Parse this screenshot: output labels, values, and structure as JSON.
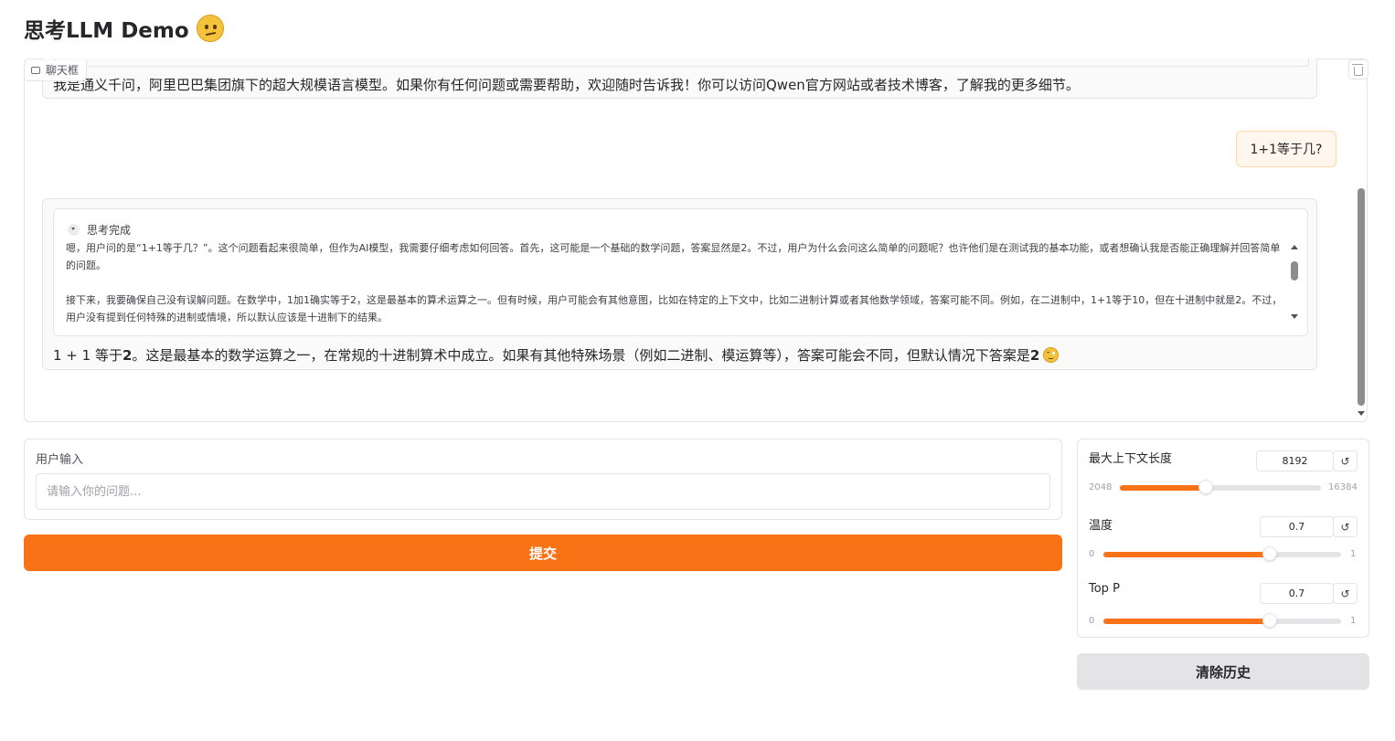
{
  "app": {
    "title": "思考LLM Demo",
    "title_emoji": "thinking-face-icon"
  },
  "chatbot": {
    "label": "聊天框",
    "messages": [
      {
        "role": "assistant",
        "text": "我是通义千问，阿里巴巴集团旗下的超大规模语言模型。如果你有任何问题或需要帮助，欢迎随时告诉我！你可以访问Qwen官方网站或者技术博客，了解我的更多细节。"
      },
      {
        "role": "user",
        "text": "1+1等于几?"
      },
      {
        "role": "assistant",
        "thinking": {
          "status": "思考完成",
          "paragraphs": [
            "嗯，用户问的是“1+1等于几？”。这个问题看起来很简单，但作为AI模型，我需要仔细考虑如何回答。首先，这可能是一个基础的数学问题，答案显然是2。不过，用户为什么会问这么简单的问题呢？也许他们是在测试我的基本功能，或者想确认我是否能正确理解并回答简单的问题。",
            "接下来，我要确保自己没有误解问题。在数学中，1加1确实等于2，这是最基本的算术运算之一。但有时候，用户可能会有其他意图，比如在特定的上下文中，比如二进制计算或者其他数学领域，答案可能不同。例如，在二进制中，1+1等于10，但在十进制中就是2。不过，用户没有提到任何特殊的进制或情境，所以默认应该是十进制下的结果。"
          ]
        },
        "answer": {
          "prefix": "1 + 1 等于 ",
          "value": "2",
          "middle": "。这是最基本的数学运算之一，在常规的十进制算术中成立。如果有其他特殊场景（例如二进制、模运算等），答案可能会不同，但默认情况下答案是 ",
          "value2": "2",
          "emoji": "smiling-face-icon"
        }
      }
    ]
  },
  "input": {
    "label": "用户输入",
    "placeholder": "请输入你的问题...",
    "value": ""
  },
  "buttons": {
    "submit": "提交",
    "clear": "清除历史"
  },
  "settings": {
    "max_length": {
      "label": "最大上下文长度",
      "value": "8192",
      "min": "2048",
      "max": "16384",
      "fraction": 0.4286
    },
    "temperature": {
      "label": "温度",
      "value": "0.7",
      "min": "0",
      "max": "1",
      "fraction": 0.7
    },
    "top_p": {
      "label": "Top P",
      "value": "0.7",
      "min": "0",
      "max": "1",
      "fraction": 0.7
    },
    "reset_symbol": "↺"
  },
  "colors": {
    "accent": "#f97316",
    "user_bubble_bg": "#fff7ed",
    "border": "#e4e4e7",
    "clear_button_bg": "#e4e4e7"
  }
}
